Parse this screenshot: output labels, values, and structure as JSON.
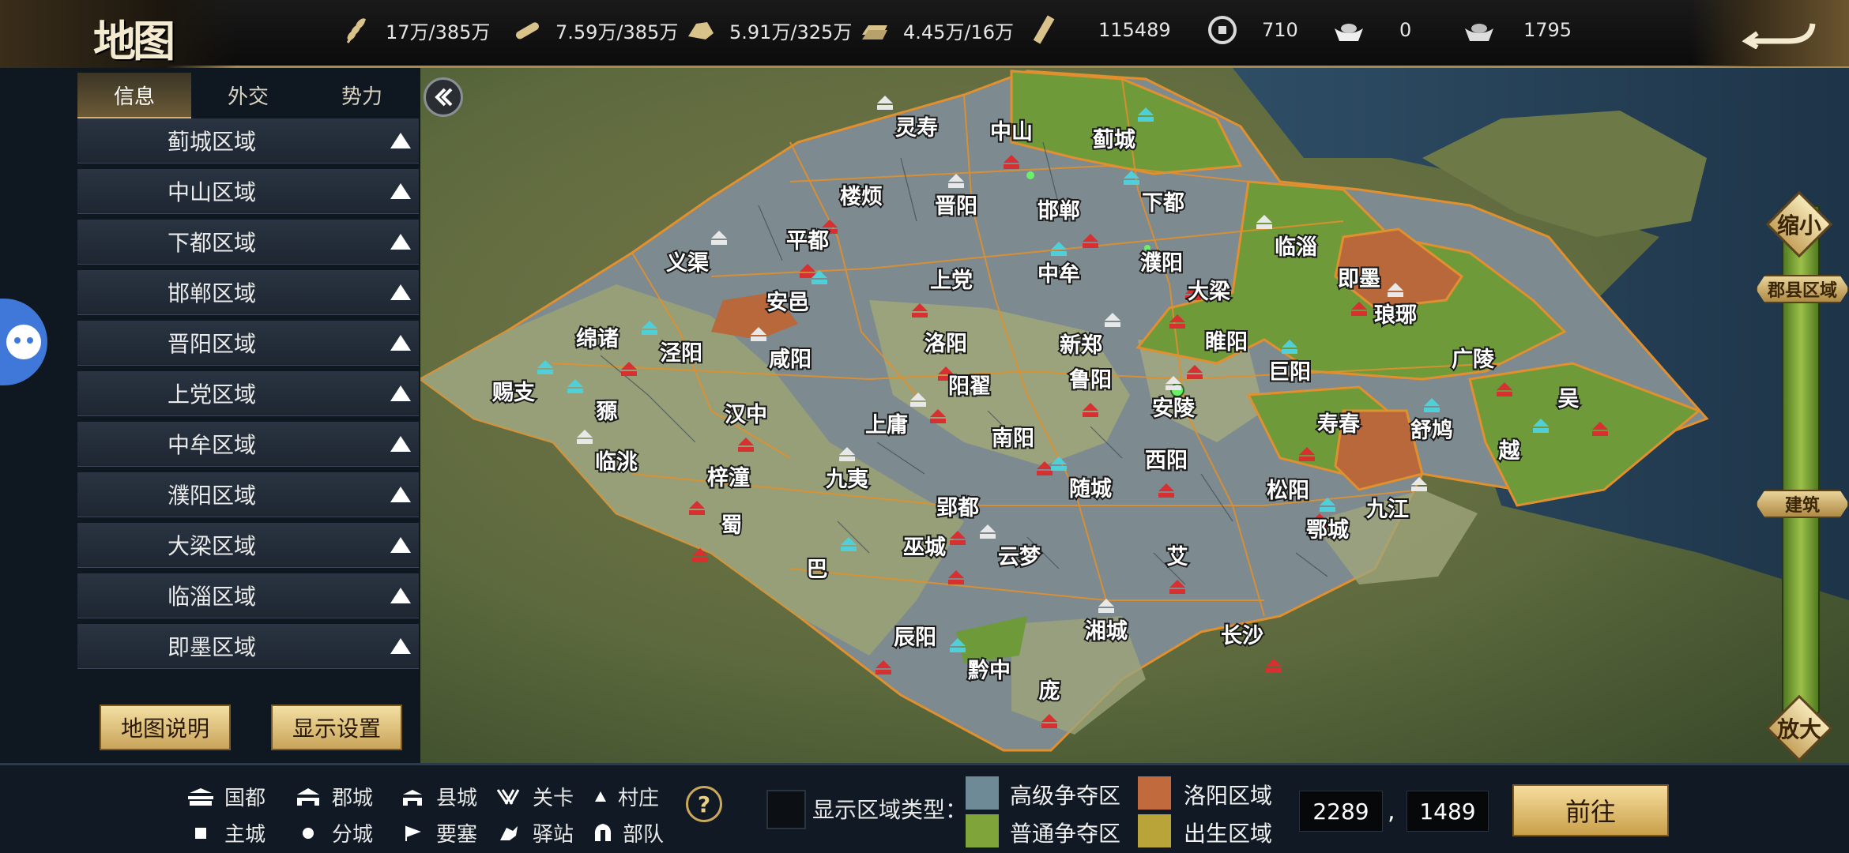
{
  "header": {
    "title": "地图"
  },
  "resources": [
    {
      "icon": "wheat-icon",
      "value": "17万/385万"
    },
    {
      "icon": "wood-icon",
      "value": "7.59万/385万"
    },
    {
      "icon": "stone-icon",
      "value": "5.91万/325万"
    },
    {
      "icon": "iron-ingot-icon",
      "value": "4.45万/16万"
    },
    {
      "icon": "order-token-icon",
      "value": "115489"
    },
    {
      "icon": "copper-coin-icon",
      "value": "710"
    },
    {
      "icon": "gold-ingot-icon",
      "value": "0"
    },
    {
      "icon": "silver-ingot-icon",
      "value": "1795"
    }
  ],
  "sidebar": {
    "tabs": [
      "信息",
      "外交",
      "势力"
    ],
    "active_tab": "信息",
    "regions": [
      "蓟城区域",
      "中山区域",
      "下都区域",
      "邯郸区域",
      "晋阳区域",
      "上党区域",
      "中牟区域",
      "濮阳区域",
      "大梁区域",
      "临淄区域",
      "即墨区域"
    ],
    "map_info_button": "地图说明",
    "display_settings_button": "显示设置"
  },
  "zoom": {
    "out_label": "缩小",
    "in_label": "放大",
    "level_tag": "郡县区域",
    "building_tag": "建筑"
  },
  "map": {
    "cities": [
      {
        "name": "灵寿",
        "type": "gray"
      },
      {
        "name": "中山",
        "type": "gray"
      },
      {
        "name": "蓟城",
        "type": "green"
      },
      {
        "name": "楼烦",
        "type": "gray"
      },
      {
        "name": "晋阳",
        "type": "gray"
      },
      {
        "name": "邯郸",
        "type": "gray"
      },
      {
        "name": "下都",
        "type": "gray"
      },
      {
        "name": "平都",
        "type": "gray"
      },
      {
        "name": "义渠",
        "type": "gray"
      },
      {
        "name": "上党",
        "type": "gray"
      },
      {
        "name": "中牟",
        "type": "gray"
      },
      {
        "name": "濮阳",
        "type": "gray"
      },
      {
        "name": "临淄",
        "type": "green"
      },
      {
        "name": "即墨",
        "type": "orange"
      },
      {
        "name": "安邑",
        "type": "orange"
      },
      {
        "name": "大梁",
        "type": "gray"
      },
      {
        "name": "琅琊",
        "type": "green"
      },
      {
        "name": "绵诸",
        "type": "gray"
      },
      {
        "name": "泾阳",
        "type": "gray"
      },
      {
        "name": "洛阳",
        "type": "gray"
      },
      {
        "name": "新郑",
        "type": "gray"
      },
      {
        "name": "睢阳",
        "type": "green"
      },
      {
        "name": "巨阳",
        "type": "gray"
      },
      {
        "name": "广陵",
        "type": "gray"
      },
      {
        "name": "咸阳",
        "type": "gray"
      },
      {
        "name": "鲁阳",
        "type": "gray"
      },
      {
        "name": "赐支",
        "type": "gray"
      },
      {
        "name": "阳翟",
        "type": "gray"
      },
      {
        "name": "安陵",
        "type": "gray"
      },
      {
        "name": "吴",
        "type": "green"
      },
      {
        "name": "豲",
        "type": "gray"
      },
      {
        "name": "汉中",
        "type": "gray"
      },
      {
        "name": "上庸",
        "type": "gray"
      },
      {
        "name": "寿春",
        "type": "green"
      },
      {
        "name": "舒鸠",
        "type": "orange"
      },
      {
        "name": "南阳",
        "type": "gray"
      },
      {
        "name": "临洮",
        "type": "gray"
      },
      {
        "name": "西阳",
        "type": "gray"
      },
      {
        "name": "越",
        "type": "green"
      },
      {
        "name": "梓潼",
        "type": "gray"
      },
      {
        "name": "九夷",
        "type": "gray"
      },
      {
        "name": "松阳",
        "type": "gray"
      },
      {
        "name": "随城",
        "type": "gray"
      },
      {
        "name": "郢都",
        "type": "gray"
      },
      {
        "name": "九江",
        "type": "gray"
      },
      {
        "name": "蜀",
        "type": "gray"
      },
      {
        "name": "鄂城",
        "type": "gray"
      },
      {
        "name": "巫城",
        "type": "gray"
      },
      {
        "name": "云梦",
        "type": "gray"
      },
      {
        "name": "艾",
        "type": "gray"
      },
      {
        "name": "巴",
        "type": "gray"
      },
      {
        "name": "辰阳",
        "type": "gray"
      },
      {
        "name": "湘城",
        "type": "gray"
      },
      {
        "name": "长沙",
        "type": "gray"
      },
      {
        "name": "黔中",
        "type": "gray"
      },
      {
        "name": "庞",
        "type": "gray"
      }
    ]
  },
  "legend": {
    "items": [
      {
        "icon": "capital-icon",
        "label": "国都"
      },
      {
        "icon": "prefecture-city-icon",
        "label": "郡城"
      },
      {
        "icon": "county-city-icon",
        "label": "县城"
      },
      {
        "icon": "pass-icon",
        "label": "关卡"
      },
      {
        "icon": "village-icon",
        "label": "村庄"
      },
      {
        "icon": "main-city-icon",
        "label": "主城"
      },
      {
        "icon": "branch-city-icon",
        "label": "分城"
      },
      {
        "icon": "fortress-icon",
        "label": "要塞"
      },
      {
        "icon": "post-station-icon",
        "label": "驿站"
      },
      {
        "icon": "troop-icon",
        "label": "部队"
      }
    ],
    "region_type_label": "显示区域类型：",
    "region_types": [
      {
        "label": "高级争夺区",
        "color": "#6e8a96"
      },
      {
        "label": "洛阳区域",
        "color": "#c06a3e"
      },
      {
        "label": "普通争夺区",
        "color": "#7fa43a"
      },
      {
        "label": "出生区域",
        "color": "#b8a438"
      }
    ]
  },
  "coords": {
    "x": "2289",
    "y": "1489",
    "separator": ","
  },
  "goto_button": "前往",
  "colors": {
    "accent_gold": "#c9a04a",
    "region_gray": "#7d8a90",
    "region_green": "#6f9a3a",
    "region_orange": "#b8683a"
  }
}
